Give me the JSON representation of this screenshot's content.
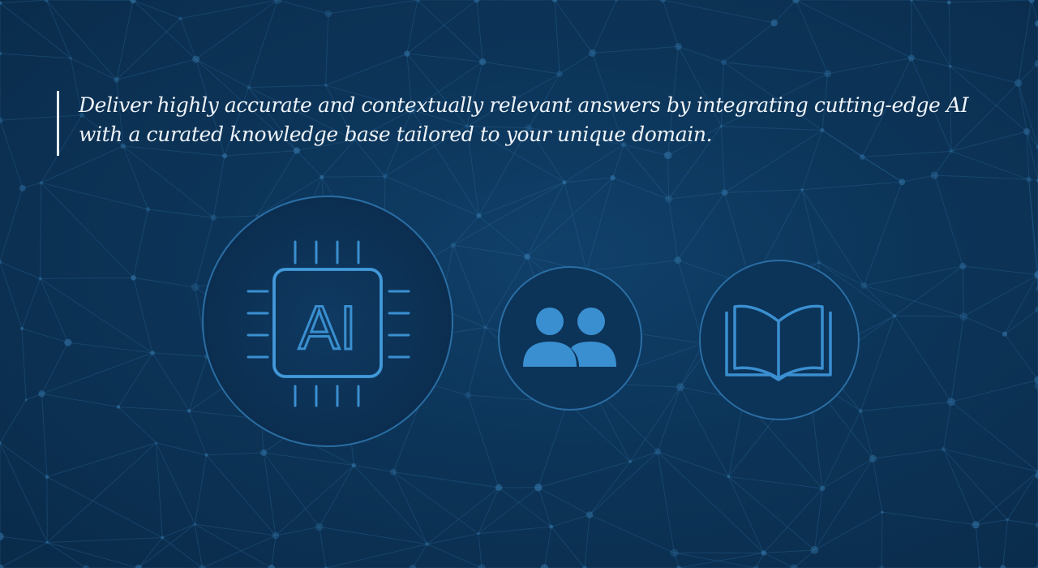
{
  "headline": {
    "line1": "Deliver highly accurate and contextually relevant answers by integrating cutting-edge AI",
    "line2": "with a curated knowledge base tailored to your unique domain."
  },
  "icons": {
    "chip": {
      "name": "ai-chip-icon",
      "label": "AI"
    },
    "people": {
      "name": "people-icon"
    },
    "book": {
      "name": "open-book-icon"
    }
  },
  "colors": {
    "background": "#0c3458",
    "accent": "#3a8fd0",
    "text": "#eef3f8"
  }
}
